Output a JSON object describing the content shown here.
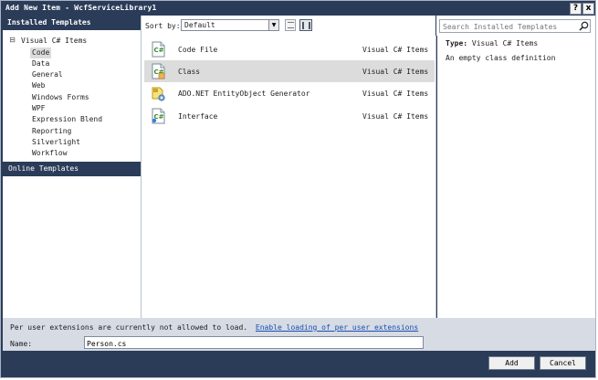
{
  "window": {
    "title": "Add New Item - WcfServiceLibrary1",
    "help_glyph": "?",
    "close_glyph": "x"
  },
  "sidebar": {
    "header": "Installed Templates",
    "root": {
      "toggle": "⊟",
      "label": "Visual C# Items"
    },
    "items": [
      {
        "label": "Code",
        "selected": true
      },
      {
        "label": "Data"
      },
      {
        "label": "General"
      },
      {
        "label": "Web"
      },
      {
        "label": "Windows Forms"
      },
      {
        "label": "WPF"
      },
      {
        "label": "Expression Blend"
      },
      {
        "label": "Reporting"
      },
      {
        "label": "Silverlight"
      },
      {
        "label": "Workflow"
      }
    ],
    "online": "Online Templates"
  },
  "toolbar": {
    "sort_label": "Sort by:",
    "sort_value": "Default",
    "dropdown_glyph": "▼"
  },
  "templates": [
    {
      "name": "Code File",
      "lang": "Visual C# Items",
      "icon": "code-file-icon"
    },
    {
      "name": "Class",
      "lang": "Visual C# Items",
      "icon": "class-icon",
      "selected": true
    },
    {
      "name": "ADO.NET EntityObject Generator",
      "lang": "Visual C# Items",
      "icon": "entity-generator-icon"
    },
    {
      "name": "Interface",
      "lang": "Visual C# Items",
      "icon": "interface-icon"
    }
  ],
  "search": {
    "placeholder": "Search Installed Templates"
  },
  "details": {
    "type_label": "Type:",
    "type_value": "Visual C# Items",
    "description": "An empty class definition"
  },
  "extensions": {
    "message": "Per user extensions are currently not allowed to load.",
    "link": "Enable loading of per user extensions"
  },
  "name_field": {
    "label": "Name:",
    "value": "Person.cs"
  },
  "buttons": {
    "add": "Add",
    "cancel": "Cancel"
  },
  "colors": {
    "chrome": "#2b3c59",
    "selected_row": "#dcdcdc",
    "bottom_panel": "#d6dbe4",
    "link": "#1a4fb0"
  }
}
